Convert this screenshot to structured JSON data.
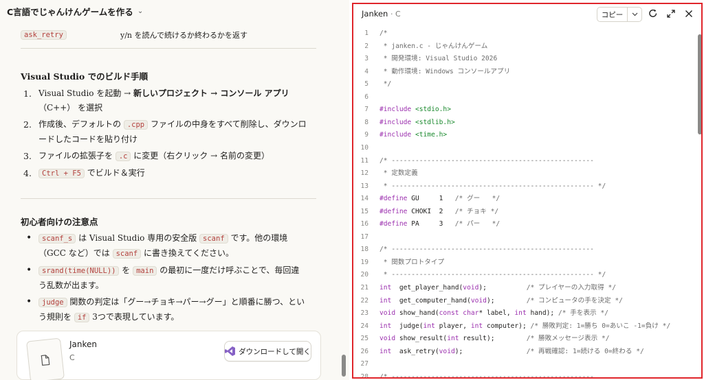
{
  "left": {
    "title": "C言語でじゃんけんゲームを作る",
    "ask_retry": {
      "code": "ask_retry",
      "desc": "y/n を読んで続けるか終わるかを返す"
    },
    "build_heading": "Visual Studio でのビルド手順",
    "build_steps": [
      {
        "num": "1.",
        "pre": "Visual Studio を起動 → ",
        "bold": "新しいプロジェクト → コンソール アプリ",
        "post": "（C++） を選択"
      },
      {
        "num": "2.",
        "pre": "作成後、デフォルトの ",
        "code": ".cpp",
        "post": " ファイルの中身をすべて削除し、ダウンロードしたコードを貼り付け"
      },
      {
        "num": "3.",
        "pre": "ファイルの拡張子を ",
        "code": ".c",
        "post": " に変更（右クリック → 名前の変更）"
      },
      {
        "num": "4.",
        "pre": "",
        "code": "Ctrl + F5",
        "post": " でビルド＆実行"
      }
    ],
    "notes_heading": "初心者向けの注意点",
    "notes": [
      {
        "c1": "scanf_s",
        "t1": " は Visual Studio 専用の安全版 ",
        "c2": "scanf",
        "t2": " です。他の環境（GCC など）では ",
        "c3": "scanf",
        "t3": " に書き換えてください。"
      },
      {
        "c1": "srand(time(NULL))",
        "t1": " を ",
        "c2": "main",
        "t2": " の最初に一度だけ呼ぶことで、毎回違う乱数が出ます。",
        "c3": "",
        "t3": ""
      },
      {
        "c1": "judge",
        "t1": " 関数の判定は「グー→チョキ→パー→グー」と順番に勝つ、という規則を ",
        "c2": "if",
        "t2": " 3つで表現しています。",
        "c3": "",
        "t3": ""
      }
    ],
    "card": {
      "title": "Janken",
      "subtitle": "C",
      "download_label": "ダウンロードして開く"
    }
  },
  "right": {
    "title": "Janken",
    "lang": "· C",
    "copy_label": "コピー",
    "icons": [
      "refresh-icon",
      "expand-icon",
      "close-icon"
    ],
    "lines": [
      [
        [
          "cm",
          "/*"
        ]
      ],
      [
        [
          "cm",
          " * janken.c - じゃんけんゲーム"
        ]
      ],
      [
        [
          "cm",
          " * 開発環境: Visual Studio 2026"
        ]
      ],
      [
        [
          "cm",
          " * 動作環境: Windows コンソールアプリ"
        ]
      ],
      [
        [
          "cm",
          " */"
        ]
      ],
      [],
      [
        [
          "pp",
          "#include "
        ],
        [
          "inc",
          "<stdio.h>"
        ]
      ],
      [
        [
          "pp",
          "#include "
        ],
        [
          "inc",
          "<stdlib.h>"
        ]
      ],
      [
        [
          "pp",
          "#include "
        ],
        [
          "inc",
          "<time.h>"
        ]
      ],
      [],
      [
        [
          "cm",
          "/* ---------------------------------------------------"
        ]
      ],
      [
        [
          "cm",
          " * 定数定義"
        ]
      ],
      [
        [
          "cm",
          " * --------------------------------------------------- */"
        ]
      ],
      [
        [
          "pp",
          "#define "
        ],
        [
          "tx",
          "GU     1   "
        ],
        [
          "cm",
          "/* グー   */"
        ]
      ],
      [
        [
          "pp",
          "#define "
        ],
        [
          "tx",
          "CHOKI  2   "
        ],
        [
          "cm",
          "/* チョキ */"
        ]
      ],
      [
        [
          "pp",
          "#define "
        ],
        [
          "tx",
          "PA     3   "
        ],
        [
          "cm",
          "/* パー   */"
        ]
      ],
      [],
      [
        [
          "cm",
          "/* ---------------------------------------------------"
        ]
      ],
      [
        [
          "cm",
          " * 関数プロトタイプ"
        ]
      ],
      [
        [
          "cm",
          " * --------------------------------------------------- */"
        ]
      ],
      [
        [
          "kw",
          "int"
        ],
        [
          "tx",
          "  get_player_hand("
        ],
        [
          "kw",
          "void"
        ],
        [
          "tx",
          ");          "
        ],
        [
          "cm",
          "/* プレイヤーの入力取得 */"
        ]
      ],
      [
        [
          "kw",
          "int"
        ],
        [
          "tx",
          "  get_computer_hand("
        ],
        [
          "kw",
          "void"
        ],
        [
          "tx",
          ");        "
        ],
        [
          "cm",
          "/* コンピュータの手を決定 */"
        ]
      ],
      [
        [
          "kw",
          "void"
        ],
        [
          "tx",
          " show_hand("
        ],
        [
          "kw",
          "const char"
        ],
        [
          "tx",
          "* label, "
        ],
        [
          "kw",
          "int"
        ],
        [
          "tx",
          " hand); "
        ],
        [
          "cm",
          "/* 手を表示 */"
        ]
      ],
      [
        [
          "kw",
          "int"
        ],
        [
          "tx",
          "  judge("
        ],
        [
          "kw",
          "int"
        ],
        [
          "tx",
          " player, "
        ],
        [
          "kw",
          "int"
        ],
        [
          "tx",
          " computer); "
        ],
        [
          "cm",
          "/* 勝敗判定: 1=勝ち 0=あいこ -1=負け */"
        ]
      ],
      [
        [
          "kw",
          "void"
        ],
        [
          "tx",
          " show_result("
        ],
        [
          "kw",
          "int"
        ],
        [
          "tx",
          " result);        "
        ],
        [
          "cm",
          "/* 勝敗メッセージ表示 */"
        ]
      ],
      [
        [
          "kw",
          "int"
        ],
        [
          "tx",
          "  ask_retry("
        ],
        [
          "kw",
          "void"
        ],
        [
          "tx",
          ");                "
        ],
        [
          "cm",
          "/* 再戦確認: 1=続ける 0=終わる */"
        ]
      ],
      [],
      [
        [
          "cm",
          "/* ---------------------------------------------------"
        ]
      ]
    ]
  }
}
